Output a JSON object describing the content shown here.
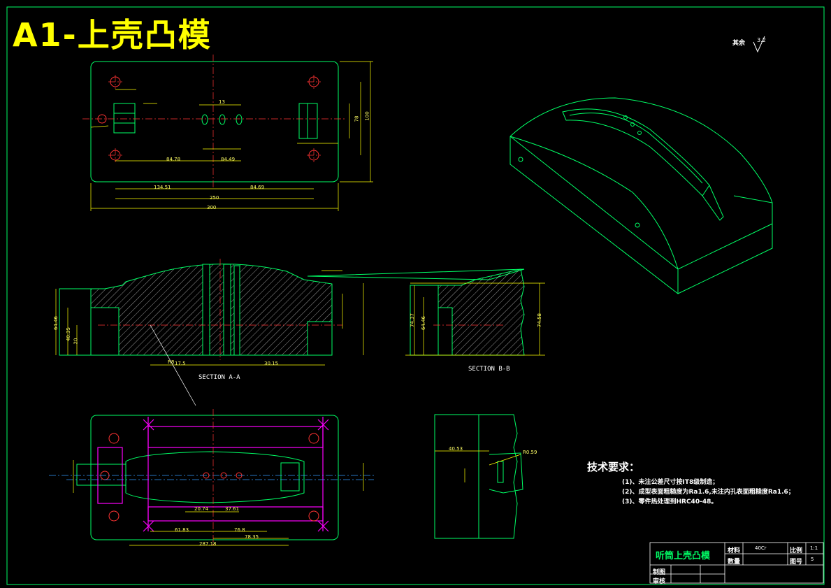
{
  "title": "A1-上壳凸模",
  "roughness": {
    "label": "其余",
    "value": "3.2"
  },
  "sections": {
    "aa": "SECTION A-A",
    "bb": "SECTION B-B"
  },
  "requirements": {
    "title": "技术要求：",
    "items": [
      "(1)、未注公差尺寸按IT8级制造；",
      "(2)、成型表面粗糙度为Ra1.6,未注内孔表面粗糙度Ra1.6；",
      "(3)、零件热处理到HRC40-48。"
    ]
  },
  "title_block": {
    "part_name": "听筒上壳凸模",
    "material_label": "材料",
    "material_value": "40Cr",
    "scale_label": "比例",
    "scale_value": "1:1",
    "quantity_label": "数量",
    "drawing_no_label": "图号",
    "drawing_no_value": "5",
    "drawn_label": "制图",
    "checked_label": "审核"
  },
  "dims": {
    "top_total": "300",
    "top_half_left": "134.51",
    "top_half_right": "84.69",
    "top_mid": "250",
    "top_span_left": "84.78",
    "top_span_right": "84.49",
    "top_height": "78",
    "top_height2": "100",
    "top_small": "13",
    "aa_h1": "64.46",
    "aa_h2": "40.35",
    "aa_h3": "20",
    "aa_w1": "17.5",
    "aa_w2": "30.15",
    "aa_r": "R8",
    "bb_h1": "74.37",
    "bb_h2": "64.46",
    "bb_h3": "74.58",
    "bot_w1": "61.83",
    "bot_w2": "76.8",
    "bot_w3": "78.35",
    "bot_total": "287.18",
    "bot_a": "20.74",
    "bot_b": "37.61",
    "detail_w": "40.53",
    "detail_r": "R0.59"
  },
  "colors": {
    "outline": "#00ff66",
    "dim": "#ffff00",
    "center": "#ff3333",
    "magenta": "#ff00ff",
    "hatch": "#ffffff",
    "blue": "#3399ff"
  }
}
